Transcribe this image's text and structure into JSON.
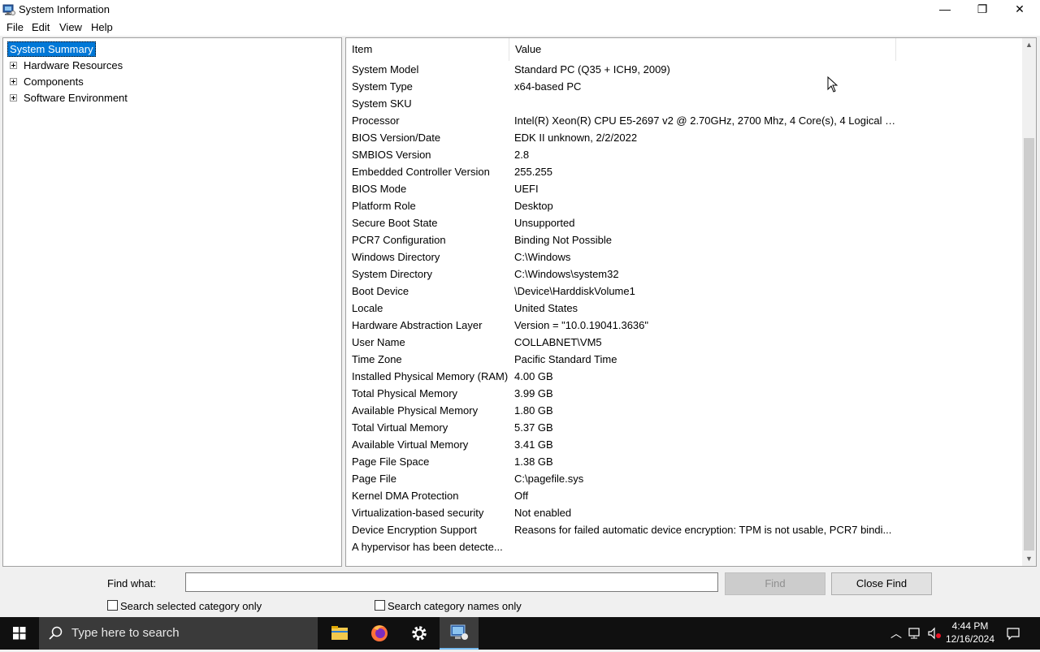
{
  "window": {
    "title": "System Information",
    "minimize_glyph": "—",
    "restore_glyph": "❐",
    "close_glyph": "✕"
  },
  "menu": [
    "File",
    "Edit",
    "View",
    "Help"
  ],
  "tree": {
    "selected": "System Summary",
    "children": [
      "Hardware Resources",
      "Components",
      "Software Environment"
    ]
  },
  "table": {
    "headers": {
      "item": "Item",
      "value": "Value"
    },
    "rows": [
      {
        "item": "System Model",
        "value": "Standard PC (Q35 + ICH9, 2009)"
      },
      {
        "item": "System Type",
        "value": "x64-based PC"
      },
      {
        "item": "System SKU",
        "value": ""
      },
      {
        "item": "Processor",
        "value": "Intel(R) Xeon(R) CPU E5-2697 v2 @ 2.70GHz, 2700 Mhz, 4 Core(s), 4 Logical Pr..."
      },
      {
        "item": "BIOS Version/Date",
        "value": "EDK II unknown, 2/2/2022"
      },
      {
        "item": "SMBIOS Version",
        "value": "2.8"
      },
      {
        "item": "Embedded Controller Version",
        "value": "255.255"
      },
      {
        "item": "BIOS Mode",
        "value": "UEFI"
      },
      {
        "item": "Platform Role",
        "value": "Desktop"
      },
      {
        "item": "Secure Boot State",
        "value": "Unsupported"
      },
      {
        "item": "PCR7 Configuration",
        "value": "Binding Not Possible"
      },
      {
        "item": "Windows Directory",
        "value": "C:\\Windows"
      },
      {
        "item": "System Directory",
        "value": "C:\\Windows\\system32"
      },
      {
        "item": "Boot Device",
        "value": "\\Device\\HarddiskVolume1"
      },
      {
        "item": "Locale",
        "value": "United States"
      },
      {
        "item": "Hardware Abstraction Layer",
        "value": "Version = \"10.0.19041.3636\""
      },
      {
        "item": "User Name",
        "value": "COLLABNET\\VM5"
      },
      {
        "item": "Time Zone",
        "value": "Pacific Standard Time"
      },
      {
        "item": "Installed Physical Memory (RAM)",
        "value": "4.00 GB"
      },
      {
        "item": "Total Physical Memory",
        "value": "3.99 GB"
      },
      {
        "item": "Available Physical Memory",
        "value": "1.80 GB"
      },
      {
        "item": "Total Virtual Memory",
        "value": "5.37 GB"
      },
      {
        "item": "Available Virtual Memory",
        "value": "3.41 GB"
      },
      {
        "item": "Page File Space",
        "value": "1.38 GB"
      },
      {
        "item": "Page File",
        "value": "C:\\pagefile.sys"
      },
      {
        "item": "Kernel DMA Protection",
        "value": "Off"
      },
      {
        "item": "Virtualization-based security",
        "value": "Not enabled"
      },
      {
        "item": "Device Encryption Support",
        "value": "Reasons for failed automatic device encryption: TPM is not usable, PCR7 bindi..."
      },
      {
        "item": "A hypervisor has been detecte...",
        "value": ""
      }
    ]
  },
  "find": {
    "label": "Find what:",
    "value": "",
    "find_button": "Find",
    "close_button": "Close Find",
    "check_selected": "Search selected category only",
    "check_names": "Search category names only"
  },
  "taskbar": {
    "search_placeholder": "Type here to search",
    "time": "4:44 PM",
    "date": "12/16/2024"
  },
  "colors": {
    "selection": "#0078d7",
    "taskbar": "#101010"
  }
}
